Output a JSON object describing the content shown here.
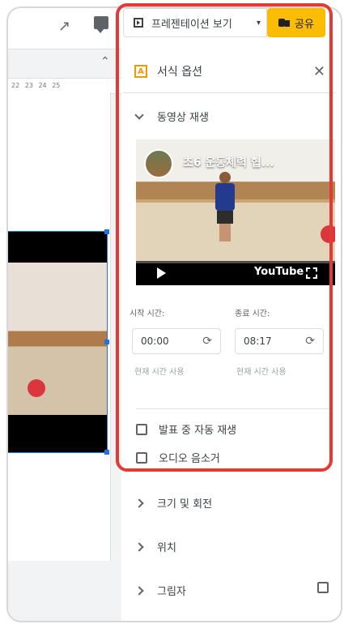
{
  "header": {
    "present_label": "프레젠테이션 보기",
    "share_label": "공유"
  },
  "ruler": {
    "ticks": [
      "22",
      "23",
      "24",
      "25"
    ]
  },
  "panel": {
    "title": "서식 옵션",
    "video_section": "동영상 재생",
    "video": {
      "title": "초6 운동체력 협...",
      "brand": "YouTube"
    },
    "start_label": "시작 시간:",
    "end_label": "종료 시간:",
    "start_value": "00:00",
    "end_value": "08:17",
    "use_current_start": "현재 시간 사용",
    "use_current_end": "현재 시간 사용",
    "autoplay_label": "발표 중 자동 재생",
    "mute_label": "오디오 음소거",
    "sections": [
      "크기 및 회전",
      "위치",
      "그림자"
    ]
  }
}
